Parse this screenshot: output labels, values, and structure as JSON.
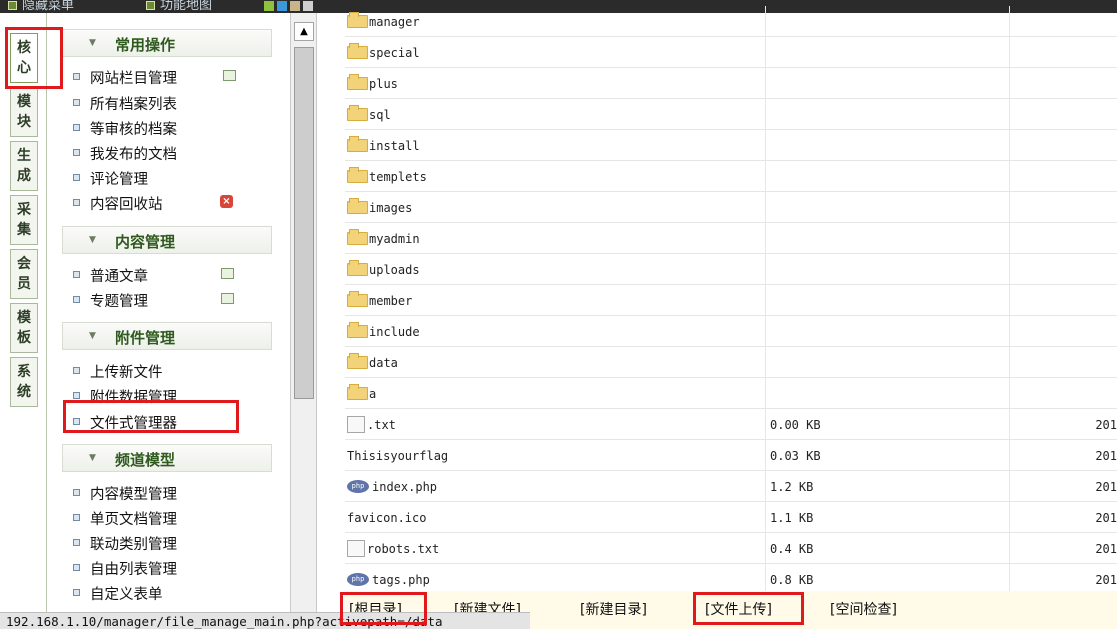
{
  "topbar": {
    "hide_menu": "隐藏菜单",
    "site_map": "功能地图"
  },
  "tabs": [
    "核心",
    "模块",
    "生成",
    "采集",
    "会员",
    "模板",
    "系统"
  ],
  "menu": {
    "sections": [
      {
        "title": "常用操作",
        "items": [
          "网站栏目管理",
          "所有档案列表",
          "等审核的档案",
          "我发布的文档",
          "评论管理",
          "内容回收站"
        ]
      },
      {
        "title": "内容管理",
        "items": [
          "普通文章",
          "专题管理"
        ]
      },
      {
        "title": "附件管理",
        "items": [
          "上传新文件",
          "附件数据管理",
          "文件式管理器"
        ]
      },
      {
        "title": "频道模型",
        "items": [
          "内容模型管理",
          "单页文档管理",
          "联动类别管理",
          "自由列表管理",
          "自定义表单"
        ]
      }
    ]
  },
  "files": [
    {
      "icon": "folder-icon",
      "name": "manager",
      "size": "",
      "date": ""
    },
    {
      "icon": "folder-icon",
      "name": "special",
      "size": "",
      "date": ""
    },
    {
      "icon": "folder-icon",
      "name": "plus",
      "size": "",
      "date": ""
    },
    {
      "icon": "folder-icon",
      "name": "sql",
      "size": "",
      "date": ""
    },
    {
      "icon": "folder-icon",
      "name": "install",
      "size": "",
      "date": ""
    },
    {
      "icon": "folder-icon",
      "name": "templets",
      "size": "",
      "date": ""
    },
    {
      "icon": "folder-icon",
      "name": "images",
      "size": "",
      "date": ""
    },
    {
      "icon": "folder-icon",
      "name": "myadmin",
      "size": "",
      "date": ""
    },
    {
      "icon": "folder-icon",
      "name": "uploads",
      "size": "",
      "date": ""
    },
    {
      "icon": "folder-icon",
      "name": "member",
      "size": "",
      "date": ""
    },
    {
      "icon": "folder-icon",
      "name": "include",
      "size": "",
      "date": ""
    },
    {
      "icon": "folder-icon",
      "name": "data",
      "size": "",
      "date": ""
    },
    {
      "icon": "folder-icon",
      "name": "a",
      "size": "",
      "date": ""
    },
    {
      "icon": "text-file-icon",
      "name": ".txt",
      "size": "0.00 KB",
      "date": "201"
    },
    {
      "icon": "",
      "name": "Thisisyourflag",
      "size": "0.03 KB",
      "date": "201"
    },
    {
      "icon": "php-file-icon",
      "name": "index.php",
      "size": "1.2 KB",
      "date": "201"
    },
    {
      "icon": "",
      "name": "favicon.ico",
      "size": "1.1 KB",
      "date": "201"
    },
    {
      "icon": "text-file-icon",
      "name": "robots.txt",
      "size": "0.4 KB",
      "date": "201"
    },
    {
      "icon": "php-file-icon",
      "name": "tags.php",
      "size": "0.8 KB",
      "date": "201"
    }
  ],
  "toolbar": {
    "root": "[根目录]",
    "new_file": "[新建文件]",
    "new_dir": "[新建目录]",
    "upload": "[文件上传]",
    "space_check": "[空间检查]"
  },
  "status": {
    "url": "192.168.1.10/manager/file_manage_main.php?activepath=/data"
  },
  "colors": {
    "highlight": "#e0191c",
    "section_title": "#2f5a1f",
    "toolbar_bg": "#fffbe8"
  }
}
